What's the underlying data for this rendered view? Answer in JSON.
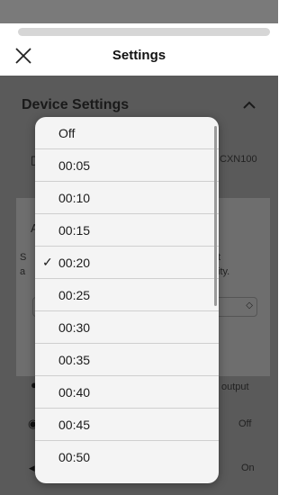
{
  "header": {
    "title": "Settings"
  },
  "section": {
    "title": "Device Settings"
  },
  "background": {
    "device_model": "CXN100",
    "modal_letter": "A",
    "modal_line1_start": "S",
    "modal_line1_end": "t",
    "modal_line2_start": "a",
    "modal_line2_end": "ity.",
    "output_label": "output",
    "toggle1_value": "Off",
    "toggle2_value": "On"
  },
  "dropdown": {
    "options": [
      "Off",
      "00:05",
      "00:10",
      "00:15",
      "00:20",
      "00:25",
      "00:30",
      "00:35",
      "00:40",
      "00:45",
      "00:50"
    ],
    "selected": "00:20",
    "check_mark": "✓"
  }
}
